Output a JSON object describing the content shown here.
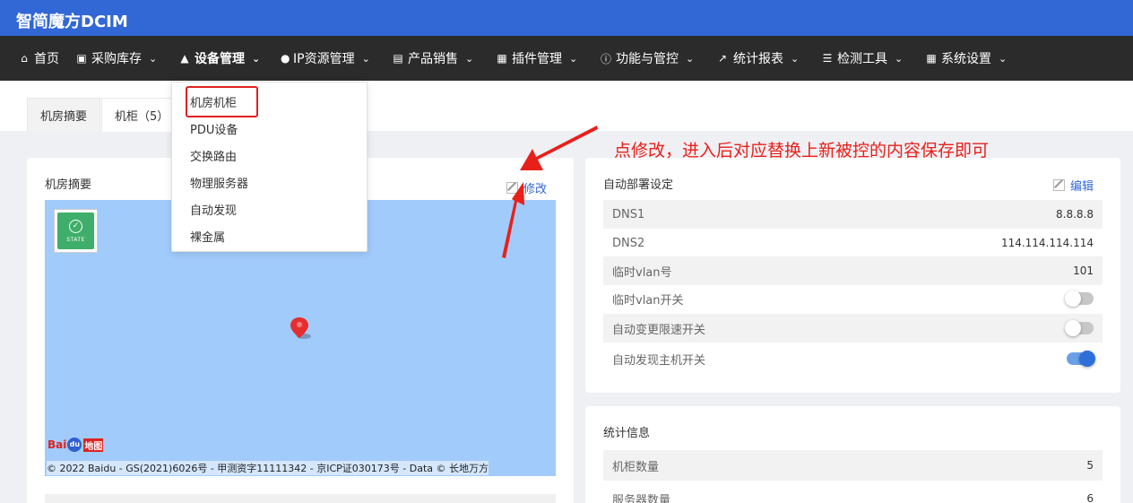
{
  "app": {
    "title": "智简魔方DCIM"
  },
  "nav": [
    {
      "icon": "home-icon",
      "label": "首页"
    },
    {
      "icon": "inbox-icon",
      "label": "采购库存"
    },
    {
      "icon": "cube-icon",
      "label": "设备管理"
    },
    {
      "icon": "map-marker-icon",
      "label": "IP资源管理"
    },
    {
      "icon": "cart-icon",
      "label": "产品销售"
    },
    {
      "icon": "grid-icon",
      "label": "插件管理"
    },
    {
      "icon": "info-icon",
      "label": "功能与管控"
    },
    {
      "icon": "line-chart-icon",
      "label": "统计报表"
    },
    {
      "icon": "list-icon",
      "label": "检测工具"
    },
    {
      "icon": "grid-icon",
      "label": "系统设置"
    }
  ],
  "tabs": [
    {
      "label": "机房摘要"
    },
    {
      "label": "机柜（5）"
    }
  ],
  "dropdown": {
    "items": [
      "机房机柜",
      "PDU设备",
      "交换路由",
      "物理服务器",
      "自动发现",
      "裸金属"
    ]
  },
  "summary_card": {
    "title": "机房摘要",
    "edit_label": "修改",
    "map": {
      "badge_text": "STATE",
      "logo_text": "Bai",
      "logo_paw": "du",
      "logo_map": "地图",
      "copyright": "© 2022 Baidu - GS(2021)6026号 - 甲测资字11111342 - 京ICP证030173号 - Data © 长地万方"
    }
  },
  "deploy_card": {
    "title": "自动部署设定",
    "edit_label": "编辑",
    "rows": [
      {
        "key": "DNS1",
        "value": "8.8.8.8"
      },
      {
        "key": "DNS2",
        "value": "114.114.114.114"
      },
      {
        "key": "临时vlan号",
        "value": "101"
      },
      {
        "key": "临时vlan开关",
        "toggle_on": false
      },
      {
        "key": "自动变更限速开关",
        "toggle_on": false
      },
      {
        "key": "自动发现主机开关",
        "toggle_on": true
      }
    ]
  },
  "stats_card": {
    "title": "统计信息",
    "rows": [
      {
        "key": "机柜数量",
        "value": "5"
      },
      {
        "key": "服务器数量",
        "value": "6"
      }
    ]
  },
  "annotation": {
    "text": "点修改，进入后对应替换上新被控的内容保存即可",
    "color": "#e8201a"
  },
  "colors": {
    "brand": "#3267d6",
    "navbar": "#2b2b2b",
    "highlight": "#e02020"
  }
}
